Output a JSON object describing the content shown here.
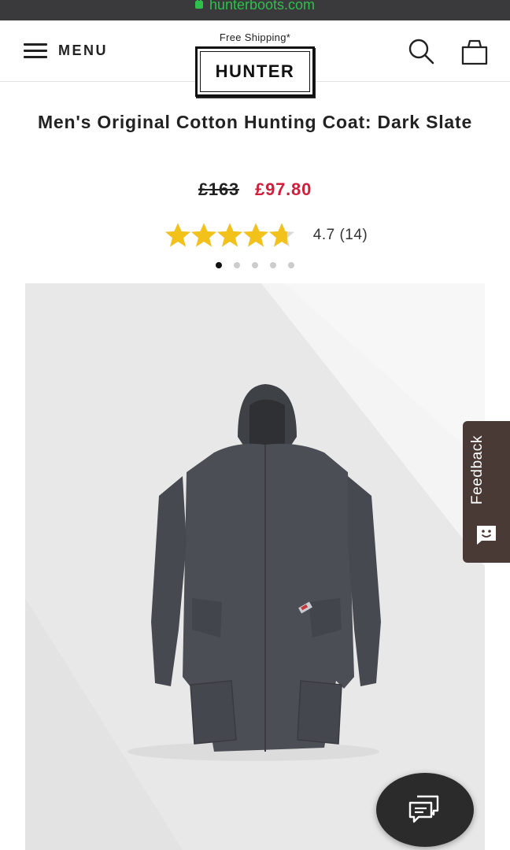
{
  "browser": {
    "url": "hunterboots.com"
  },
  "header": {
    "menu_label": "MENU",
    "shipping_text": "Free Shipping*",
    "logo_text": "HUNTER"
  },
  "product": {
    "title": "Men's Original Cotton Hunting Coat: Dark Slate",
    "old_price": "£163",
    "new_price": "£97.80",
    "rating_text": "4.7 (14)",
    "rating_value": 4.7,
    "rating_max": 5,
    "carousel": {
      "total": 5,
      "active": 1
    }
  },
  "feedback": {
    "label": "Feedback"
  },
  "colors": {
    "sale_red": "#cf1f3a",
    "star_yellow": "#f2c11a",
    "url_green": "#2fbf4d",
    "coat": "#4b4e54",
    "feedback_bg": "#4a3a36"
  }
}
